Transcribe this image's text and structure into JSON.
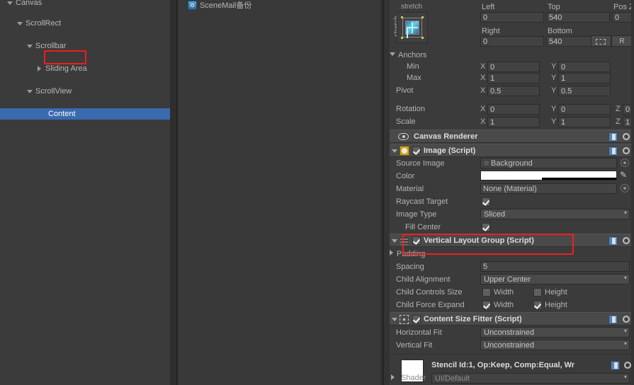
{
  "app": {
    "editor": "Unity Editor",
    "accent_selection": "#3a6ab0",
    "annotation_color": "#ee2020",
    "panel_bg": "#3b3b3b"
  },
  "hierarchy": {
    "items": [
      {
        "label": "Canvas",
        "indent": 0,
        "arrow": "down",
        "selected": false
      },
      {
        "label": "ScrollRect",
        "indent": 1,
        "arrow": "down",
        "selected": false
      },
      {
        "label": "Scrollbar",
        "indent": 2,
        "arrow": "down",
        "selected": false
      },
      {
        "label": "Sliding Area",
        "indent": 3,
        "arrow": "right",
        "selected": false
      },
      {
        "label": "ScrollView",
        "indent": 2,
        "arrow": "down",
        "selected": false
      },
      {
        "label": "Content",
        "indent": 3,
        "arrow": "none",
        "selected": true
      }
    ]
  },
  "project": {
    "scene_item": {
      "label": "SceneMail备份",
      "icon": "unity-scene-icon"
    }
  },
  "inspector": {
    "rect_transform": {
      "anchor_preset": {
        "top_label": "stretch",
        "left_label": "stretch"
      },
      "fields": [
        {
          "label": "Left",
          "value": "0"
        },
        {
          "label": "Top",
          "value": "540"
        },
        {
          "label": "Pos Z",
          "value": "0"
        },
        {
          "label": "Right",
          "value": "0"
        },
        {
          "label": "Bottom",
          "value": "540"
        }
      ],
      "blueprint_label": "",
      "raw_label": "R",
      "anchors": {
        "title": "Anchors",
        "min": {
          "label": "Min",
          "x_axis": "X",
          "x": "0",
          "y_axis": "Y",
          "y": "0"
        },
        "max": {
          "label": "Max",
          "x_axis": "X",
          "x": "1",
          "y_axis": "Y",
          "y": "1"
        }
      },
      "pivot": {
        "label": "Pivot",
        "x_axis": "X",
        "x": "0.5",
        "y_axis": "Y",
        "y": "0.5"
      },
      "rotation": {
        "label": "Rotation",
        "x_axis": "X",
        "x": "0",
        "y_axis": "Y",
        "y": "0",
        "z_axis": "Z",
        "z": "0"
      },
      "scale": {
        "label": "Scale",
        "x_axis": "X",
        "x": "1",
        "y_axis": "Y",
        "y": "1",
        "z_axis": "Z",
        "z": "1"
      }
    },
    "canvas_renderer": {
      "title": "Canvas Renderer"
    },
    "image": {
      "title": "Image (Script)",
      "enabled": true,
      "source_image": {
        "label": "Source Image",
        "value": "Background"
      },
      "color": {
        "label": "Color",
        "value_hex": "#FFFFFF",
        "alpha_pct": 45
      },
      "material": {
        "label": "Material",
        "value": "None (Material)"
      },
      "raycast_target": {
        "label": "Raycast Target",
        "checked": true
      },
      "image_type": {
        "label": "Image Type",
        "value": "Sliced"
      },
      "fill_center": {
        "label": "Fill Center",
        "checked": true
      }
    },
    "vertical_layout_group": {
      "title": "Vertical Layout Group (Script)",
      "enabled": true,
      "padding": {
        "label": "Padding"
      },
      "spacing": {
        "label": "Spacing",
        "value": "5"
      },
      "child_alignment": {
        "label": "Child Alignment",
        "value": "Upper Center"
      },
      "child_controls_size": {
        "label": "Child Controls Size",
        "width_label": "Width",
        "width_checked": false,
        "height_label": "Height",
        "height_checked": false
      },
      "child_force_expand": {
        "label": "Child Force Expand",
        "width_label": "Width",
        "width_checked": true,
        "height_label": "Height",
        "height_checked": true
      }
    },
    "content_size_fitter": {
      "title": "Content Size Fitter (Script)",
      "enabled": true,
      "horizontal_fit": {
        "label": "Horizontal Fit",
        "value": "Unconstrained"
      },
      "vertical_fit": {
        "label": "Vertical Fit",
        "value": "Unconstrained"
      }
    },
    "material": {
      "title": "Stencil Id:1, Op:Keep, Comp:Equal, Wr",
      "shader_label": "Shader",
      "shader_value": "UI/Default"
    }
  }
}
